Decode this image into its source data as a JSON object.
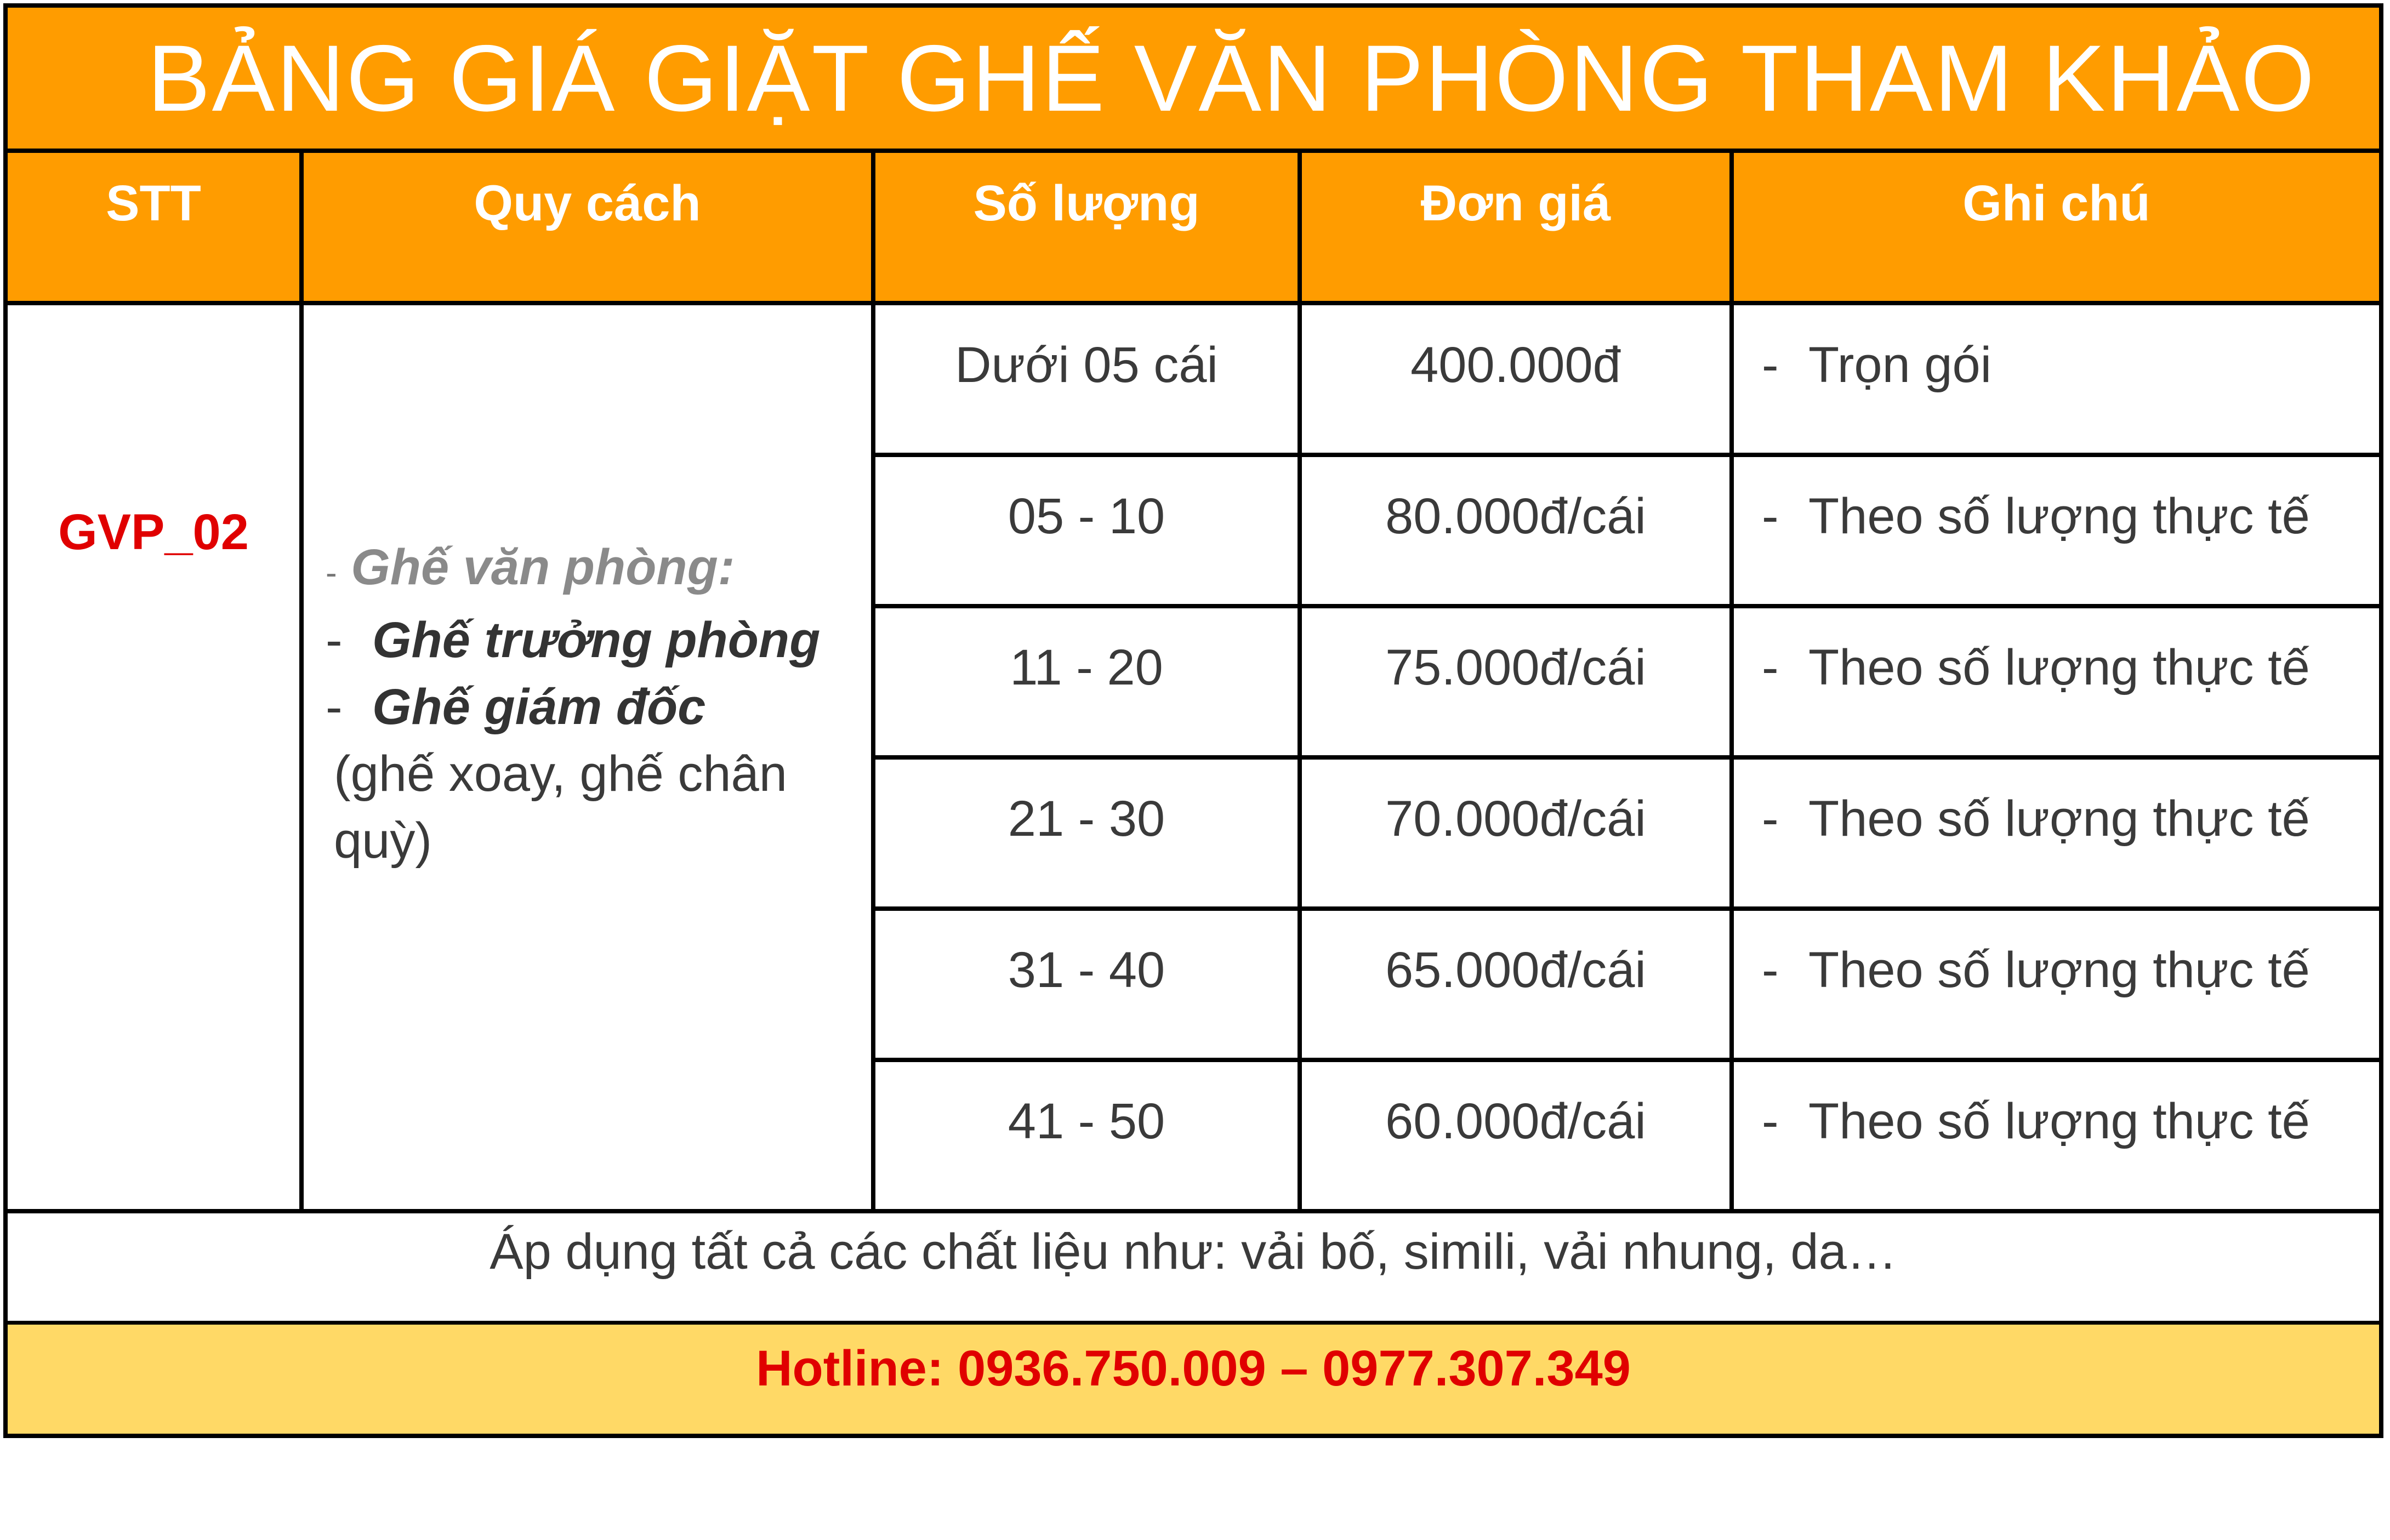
{
  "title": "BẢNG GIÁ GIẶT GHẾ VĂN PHÒNG THAM KHẢO",
  "columns": [
    "STT",
    "Quy cách",
    "Số lượng",
    "Đơn giá",
    "Ghi chú"
  ],
  "stt": "GVP_02",
  "spec": {
    "line1_dash": "-",
    "line1": "Ghế văn phòng:",
    "line2_dash": "-",
    "line2": "Ghế trưởng phòng",
    "line3_dash": "-",
    "line3": "Ghế giám đốc",
    "line4": "(ghế xoay, ghế chân",
    "line5": "quỳ)"
  },
  "rows": [
    {
      "qty": "Dưới 05 cái",
      "price": "400.000đ",
      "note": "Trọn gói"
    },
    {
      "qty": "05 - 10",
      "price": "80.000đ/cái",
      "note": "Theo số lượng thực tế"
    },
    {
      "qty": "11 - 20",
      "price": "75.000đ/cái",
      "note": "Theo số lượng thực tế"
    },
    {
      "qty": "21 - 30",
      "price": "70.000đ/cái",
      "note": "Theo số lượng thực tế"
    },
    {
      "qty": "31 - 40",
      "price": "65.000đ/cái",
      "note": "Theo số lượng thực tế"
    },
    {
      "qty": "41 - 50",
      "price": "60.000đ/cái",
      "note": "Theo số lượng thực tế"
    }
  ],
  "note_dash": "-",
  "materials_note": "Áp dụng tất cả các chất liệu như: vải bố, simili, vải nhung, da…",
  "hotline": "Hotline: 0936.750.009 – 0977.307.349",
  "colors": {
    "header": "#ff9c00",
    "hotline_bg": "#ffd966",
    "accent_red": "#e00000"
  }
}
